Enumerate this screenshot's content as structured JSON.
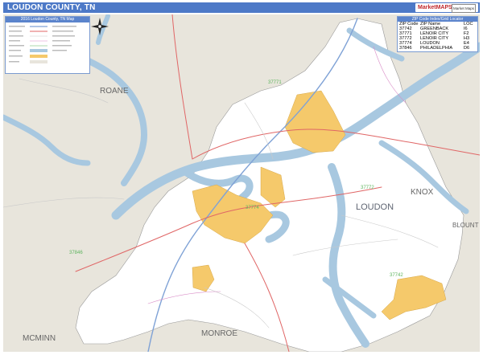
{
  "header": {
    "title": "LOUDON COUNTY, TN",
    "logo_text": "MarketMAPS",
    "logo_badge": "Market Maps"
  },
  "legend": {
    "title": "2016 Loudon County, TN Map"
  },
  "zip_table": {
    "title": "ZIP Code Index/Grid Locator",
    "columns": [
      "ZIP Code",
      "ZIP Name",
      "LOC"
    ],
    "rows": [
      {
        "zip": "37742",
        "name": "GREENBACK",
        "loc": "I6"
      },
      {
        "zip": "37771",
        "name": "LENOIR CITY",
        "loc": "F2"
      },
      {
        "zip": "37772",
        "name": "LENOIR CITY",
        "loc": "H3"
      },
      {
        "zip": "37774",
        "name": "LOUDON",
        "loc": "E4"
      },
      {
        "zip": "37846",
        "name": "PHILADELPHIA",
        "loc": "D6"
      }
    ]
  },
  "map_labels": {
    "counties": [
      "BLOUNT",
      "ROANE",
      "MONROE",
      "MCMINN",
      "KNOX",
      "LOUDON"
    ],
    "zips": [
      "37771",
      "37772",
      "37774",
      "37846",
      "37742"
    ]
  },
  "colors": {
    "title_bar": "#4d79c7",
    "water": "#a8c8e0",
    "land_outside": "#e8e5dc",
    "county": "#ffffff",
    "city": "#f5c96b"
  }
}
